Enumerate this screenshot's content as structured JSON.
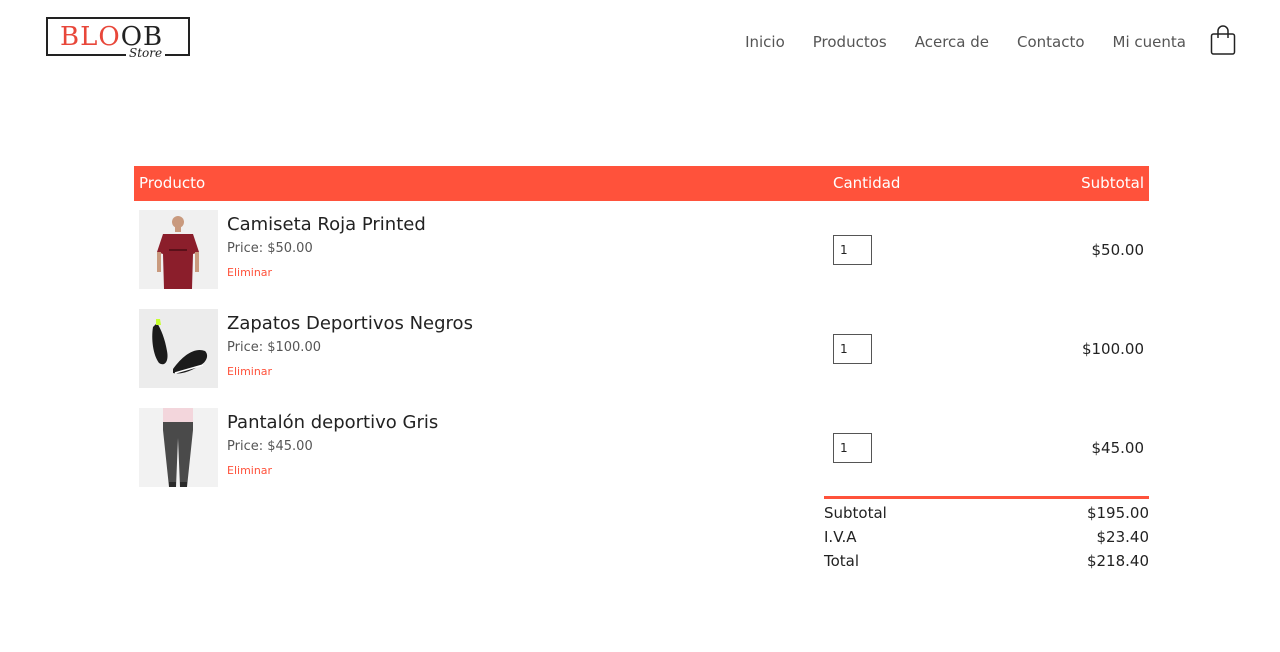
{
  "header": {
    "logo": {
      "brand_red": "BLO",
      "brand_dark": "OB",
      "sub": "Store"
    },
    "nav": [
      "Inicio",
      "Productos",
      "Acerca de",
      "Contacto",
      "Mi cuenta"
    ],
    "cart_icon": "shopping-bag-icon"
  },
  "cart": {
    "headers": {
      "product": "Producto",
      "quantity": "Cantidad",
      "subtotal": "Subtotal"
    },
    "items": [
      {
        "name": "Camiseta Roja Printed",
        "price": "Price: $50.00",
        "remove": "Eliminar",
        "quantity": "1",
        "subtotal": "$50.00"
      },
      {
        "name": "Zapatos Deportivos Negros",
        "price": "Price: $100.00",
        "remove": "Eliminar",
        "quantity": "1",
        "subtotal": "$100.00"
      },
      {
        "name": "Pantalón deportivo Gris",
        "price": "Price: $45.00",
        "remove": "Eliminar",
        "quantity": "1",
        "subtotal": "$45.00"
      }
    ],
    "totals": [
      {
        "label": "Subtotal",
        "value": "$195.00"
      },
      {
        "label": "I.V.A",
        "value": "$23.40"
      },
      {
        "label": "Total",
        "value": "$218.40"
      }
    ]
  },
  "colors": {
    "accent": "#ff523b",
    "text": "#222222"
  }
}
